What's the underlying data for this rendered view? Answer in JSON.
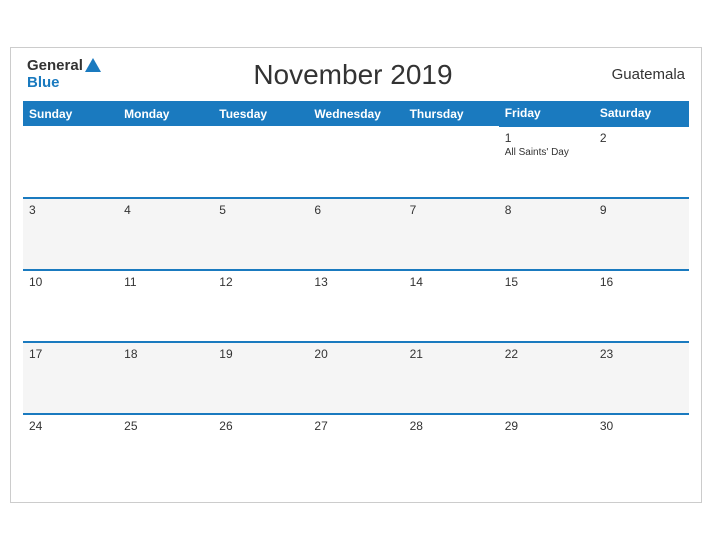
{
  "header": {
    "title": "November 2019",
    "country": "Guatemala",
    "logo_general": "General",
    "logo_blue": "Blue"
  },
  "weekdays": [
    "Sunday",
    "Monday",
    "Tuesday",
    "Wednesday",
    "Thursday",
    "Friday",
    "Saturday"
  ],
  "weeks": [
    [
      {
        "day": "",
        "holiday": ""
      },
      {
        "day": "",
        "holiday": ""
      },
      {
        "day": "",
        "holiday": ""
      },
      {
        "day": "",
        "holiday": ""
      },
      {
        "day": "",
        "holiday": ""
      },
      {
        "day": "1",
        "holiday": "All Saints' Day"
      },
      {
        "day": "2",
        "holiday": ""
      }
    ],
    [
      {
        "day": "3",
        "holiday": ""
      },
      {
        "day": "4",
        "holiday": ""
      },
      {
        "day": "5",
        "holiday": ""
      },
      {
        "day": "6",
        "holiday": ""
      },
      {
        "day": "7",
        "holiday": ""
      },
      {
        "day": "8",
        "holiday": ""
      },
      {
        "day": "9",
        "holiday": ""
      }
    ],
    [
      {
        "day": "10",
        "holiday": ""
      },
      {
        "day": "11",
        "holiday": ""
      },
      {
        "day": "12",
        "holiday": ""
      },
      {
        "day": "13",
        "holiday": ""
      },
      {
        "day": "14",
        "holiday": ""
      },
      {
        "day": "15",
        "holiday": ""
      },
      {
        "day": "16",
        "holiday": ""
      }
    ],
    [
      {
        "day": "17",
        "holiday": ""
      },
      {
        "day": "18",
        "holiday": ""
      },
      {
        "day": "19",
        "holiday": ""
      },
      {
        "day": "20",
        "holiday": ""
      },
      {
        "day": "21",
        "holiday": ""
      },
      {
        "day": "22",
        "holiday": ""
      },
      {
        "day": "23",
        "holiday": ""
      }
    ],
    [
      {
        "day": "24",
        "holiday": ""
      },
      {
        "day": "25",
        "holiday": ""
      },
      {
        "day": "26",
        "holiday": ""
      },
      {
        "day": "27",
        "holiday": ""
      },
      {
        "day": "28",
        "holiday": ""
      },
      {
        "day": "29",
        "holiday": ""
      },
      {
        "day": "30",
        "holiday": ""
      }
    ]
  ],
  "colors": {
    "header_bg": "#1a7abf",
    "header_text": "#ffffff",
    "border_top": "#1a7abf",
    "row_even_bg": "#f0f0f0",
    "row_odd_bg": "#ffffff"
  }
}
